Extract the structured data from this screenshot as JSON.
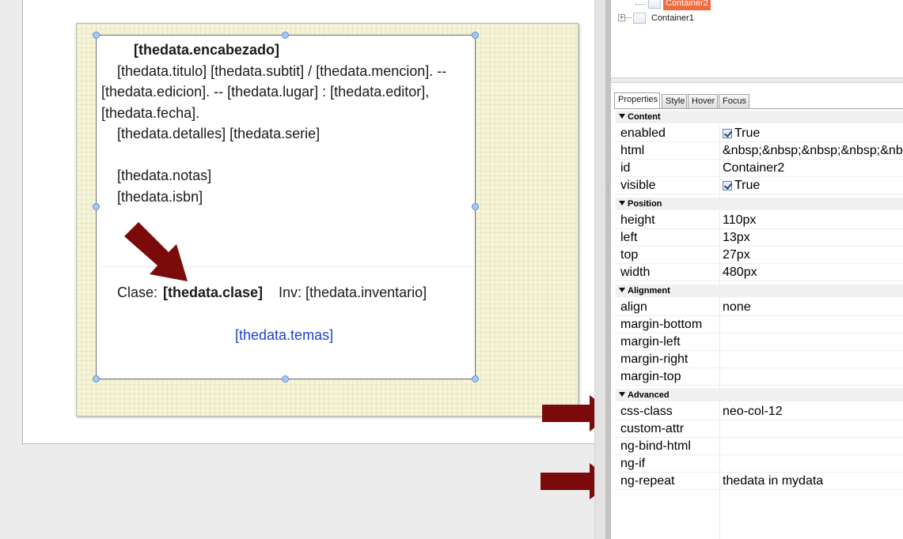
{
  "designer": {
    "lines": {
      "encabezado": "[thedata.encabezado]",
      "line1": "[thedata.titulo] [thedata.subtit] / [thedata.mencion]. --",
      "line2": "[thedata.edicion]. -- [thedata.lugar] : [thedata.editor],",
      "line3": "[thedata.fecha].",
      "line4": "[thedata.detalles] [thedata.serie]",
      "notas": "[thedata.notas]",
      "isbn": "[thedata.isbn]",
      "clase_label": "Clase:",
      "clase_value": "[thedata.clase]",
      "inv": "Inv: [thedata.inventario]",
      "temas": "[thedata.temas]"
    }
  },
  "tree": {
    "selected_label": "Container2",
    "item_label": "Container1",
    "expand_symbol": "+"
  },
  "properties": {
    "tabs": [
      "Properties",
      "Style",
      "Hover",
      "Focus"
    ],
    "sections": {
      "content": "Content",
      "position": "Position",
      "alignment": "Alignment",
      "advanced": "Advanced"
    },
    "rows": {
      "enabled": {
        "key": "enabled",
        "value": "True"
      },
      "html": {
        "key": "html",
        "value": "&nbsp;&nbsp;&nbsp;&nbsp;&nbsp;&nbsp;&n..."
      },
      "id": {
        "key": "id",
        "value": "Container2"
      },
      "visible": {
        "key": "visible",
        "value": "True"
      },
      "height": {
        "key": "height",
        "value": "110px"
      },
      "left": {
        "key": "left",
        "value": "13px"
      },
      "top": {
        "key": "top",
        "value": "27px"
      },
      "width": {
        "key": "width",
        "value": "480px"
      },
      "align": {
        "key": "align",
        "value": "none"
      },
      "margin_bottom": {
        "key": "margin-bottom",
        "value": ""
      },
      "margin_left": {
        "key": "margin-left",
        "value": ""
      },
      "margin_right": {
        "key": "margin-right",
        "value": ""
      },
      "margin_top": {
        "key": "margin-top",
        "value": ""
      },
      "css_class": {
        "key": "css-class",
        "value": "neo-col-12"
      },
      "custom_attr": {
        "key": "custom-attr",
        "value": ""
      },
      "ng_bind_html": {
        "key": "ng-bind-html",
        "value": ""
      },
      "ng_if": {
        "key": "ng-if",
        "value": ""
      },
      "ng_repeat": {
        "key": "ng-repeat",
        "value": "thedata in mydata"
      }
    }
  },
  "colors": {
    "annotation_arrow": "#7b0b0b",
    "selected_tree_item": "#f06a3c",
    "link_text": "#1f3fd1",
    "canvas_background": "#f6f4d6"
  },
  "icons": {
    "scroll_up": "▲",
    "scroll_down": "▼",
    "grip": "⋮"
  }
}
